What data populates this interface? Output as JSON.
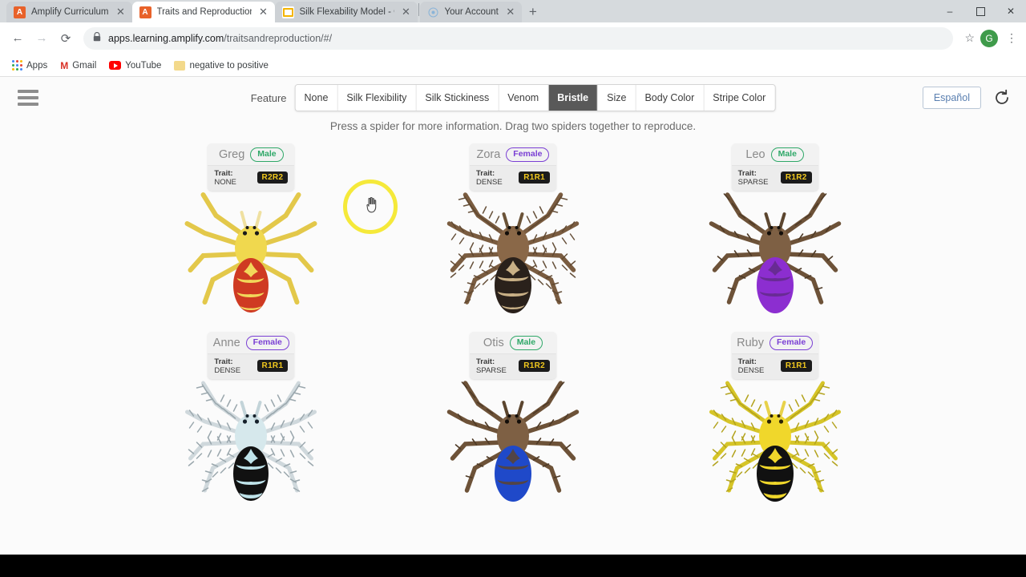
{
  "browser": {
    "tabs": [
      {
        "title": "Amplify Curriculum",
        "favicon": "amplify-icon",
        "active": false
      },
      {
        "title": "Traits and Reproduction",
        "favicon": "amplify-icon",
        "active": true
      },
      {
        "title": "Silk Flexability Model - Google S",
        "favicon": "google-slides-icon",
        "active": false
      },
      {
        "title": "Your Account",
        "favicon": "generic-page-icon",
        "active": false
      }
    ],
    "new_tab_label": "+",
    "window_controls": {
      "minimize": "–",
      "maximize": "❐",
      "close": "✕"
    },
    "nav": {
      "back": "←",
      "forward": "→",
      "reload": "⟳"
    },
    "address": {
      "lock": "🔒",
      "domain": "apps.learning.amplify.com",
      "path": "/traitsandreproduction/#/",
      "star": "☆"
    },
    "profile_initial": "G",
    "menu_icon": "⋮",
    "bookmarks": [
      {
        "label": "Apps",
        "icon": "apps-grid-icon"
      },
      {
        "label": "Gmail",
        "icon": "gmail-icon"
      },
      {
        "label": "YouTube",
        "icon": "youtube-icon"
      },
      {
        "label": "negative to positive",
        "icon": "folder-icon"
      }
    ]
  },
  "app": {
    "menu_icon": "hamburger-icon",
    "feature_label": "Feature",
    "feature_buttons": [
      {
        "label": "None",
        "selected": false
      },
      {
        "label": "Silk Flexibility",
        "selected": false
      },
      {
        "label": "Silk Stickiness",
        "selected": false
      },
      {
        "label": "Venom",
        "selected": false
      },
      {
        "label": "Bristle",
        "selected": true
      },
      {
        "label": "Size",
        "selected": false
      },
      {
        "label": "Body Color",
        "selected": false
      },
      {
        "label": "Stripe Color",
        "selected": false
      }
    ],
    "language_button": "Español",
    "reset_icon": "reset-icon",
    "instruction": "Press a spider for more information. Drag two spiders together to reproduce.",
    "trait_prefix": "Trait:"
  },
  "spiders": [
    {
      "name": "Greg",
      "sex": "Male",
      "trait": "NONE",
      "allele": "R2R2",
      "colors": {
        "leg": "#e3c84a",
        "body": "#f0d84e",
        "abdomen": "#cf3a22",
        "stripe": "#f2d75a"
      },
      "bristle": "none"
    },
    {
      "name": "Zora",
      "sex": "Female",
      "trait": "DENSE",
      "allele": "R1R1",
      "colors": {
        "leg": "#7a5c40",
        "body": "#8a6848",
        "abdomen": "#2a211b",
        "stripe": "#c9b086"
      },
      "bristle": "dense"
    },
    {
      "name": "Leo",
      "sex": "Male",
      "trait": "SPARSE",
      "allele": "R1R2",
      "colors": {
        "leg": "#6d5238",
        "body": "#7e6044",
        "abdomen": "#8c2ed0",
        "stripe": "#5c2a80"
      },
      "bristle": "sparse"
    },
    {
      "name": "Anne",
      "sex": "Female",
      "trait": "DENSE",
      "allele": "R1R1",
      "colors": {
        "leg": "#cfd8dc",
        "body": "#d6e8ec",
        "abdomen": "#111111",
        "stripe": "#bfe3ea"
      },
      "bristle": "dense"
    },
    {
      "name": "Otis",
      "sex": "Male",
      "trait": "SPARSE",
      "allele": "R1R2",
      "colors": {
        "leg": "#6d5238",
        "body": "#7e6044",
        "abdomen": "#1f49c9",
        "stripe": "#5b4430"
      },
      "bristle": "sparse"
    },
    {
      "name": "Ruby",
      "sex": "Female",
      "trait": "DENSE",
      "allele": "R1R1",
      "colors": {
        "leg": "#d6c528",
        "body": "#f0d72b",
        "abdomen": "#111111",
        "stripe": "#f0d72b"
      },
      "bristle": "dense"
    }
  ]
}
